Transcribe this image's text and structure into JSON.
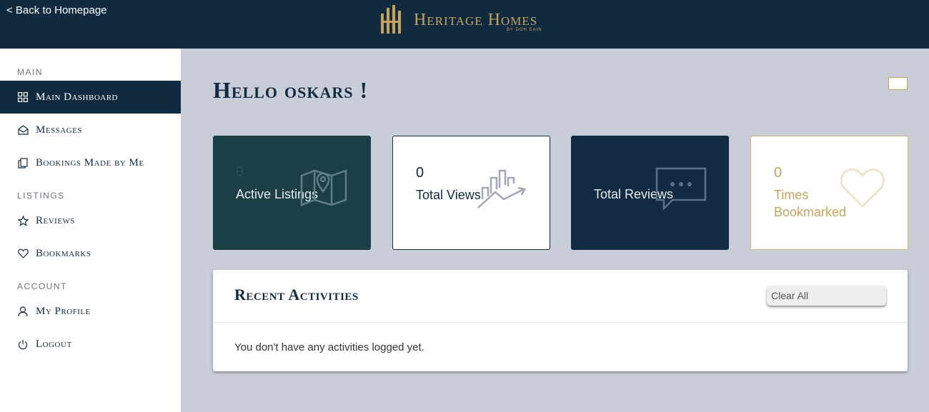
{
  "header": {
    "back_link": "< Back to Homepage",
    "logo_text": "Heritage Homes",
    "logo_sub": "BY DOH EAIN",
    "background": "#102b40",
    "accent": "#c7a35a"
  },
  "sidebar": {
    "sections": [
      {
        "title": "MAIN"
      },
      {
        "title": "LISTINGS"
      },
      {
        "title": "ACCOUNT"
      }
    ],
    "items": [
      {
        "label": "Main Dashboard",
        "icon": "grid-icon",
        "active": true
      },
      {
        "label": "Messages",
        "icon": "envelope-icon"
      },
      {
        "label": "Bookings Made by Me",
        "icon": "documents-icon"
      },
      {
        "label": "Reviews",
        "icon": "star-icon"
      },
      {
        "label": "Bookmarks",
        "icon": "heart-icon"
      },
      {
        "label": "My Profile",
        "icon": "user-icon"
      },
      {
        "label": "Logout",
        "icon": "power-icon"
      }
    ]
  },
  "main": {
    "greeting": "Hello oskars !",
    "stats": [
      {
        "value": "0",
        "label": "Active Listings",
        "icon": "map-pin-icon"
      },
      {
        "value": "0",
        "label": "Total Views",
        "icon": "chart-arrow-icon"
      },
      {
        "value": "",
        "label": "Total Reviews",
        "icon": "chat-bubble-icon"
      },
      {
        "value": "0",
        "label": "Times Bookmarked",
        "icon": "heart-outline-icon"
      }
    ],
    "activities": {
      "title": "Recent Activities",
      "clear_label": "Clear All",
      "empty_message": "You don't have any activities logged yet."
    }
  }
}
